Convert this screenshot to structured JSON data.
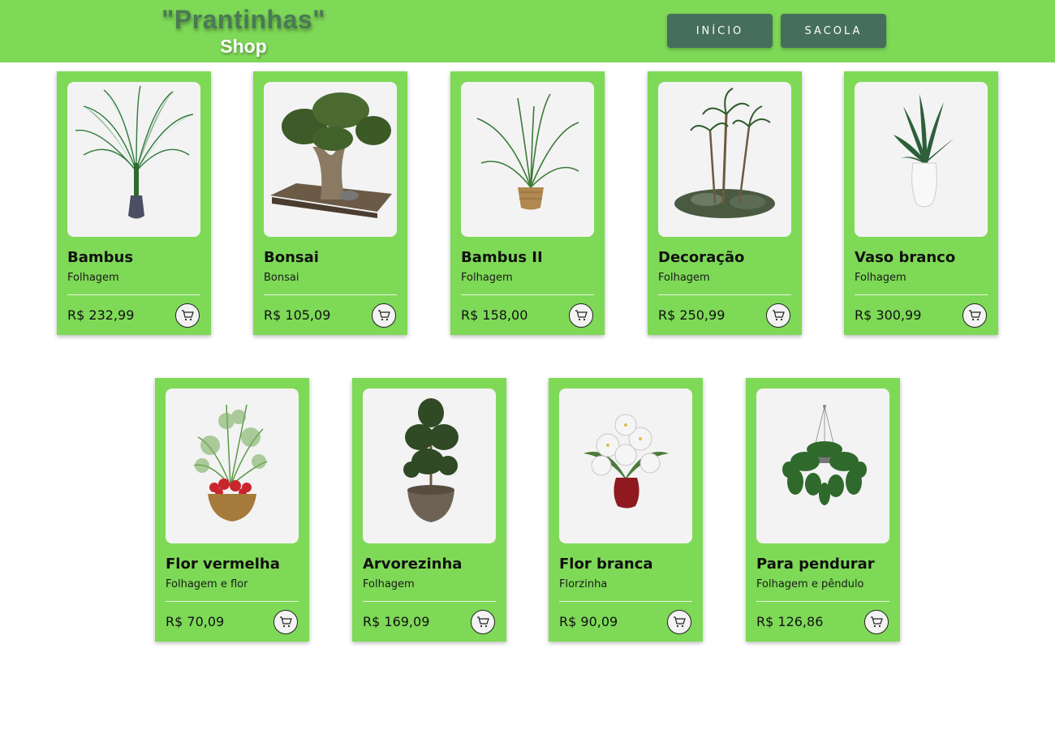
{
  "header": {
    "logo_title": "\"Prantinhas\"",
    "logo_subtitle": "Shop",
    "nav": [
      {
        "label": "INÍCIO"
      },
      {
        "label": "SACOLA"
      }
    ]
  },
  "colors": {
    "header_bg": "#7ed957",
    "card_bg": "#7ed957",
    "nav_button_bg": "#466e5d",
    "logo_title_color": "#4a7a55"
  },
  "products": [
    {
      "name": "Bambus",
      "category": "Folhagem",
      "price": "R$ 232,99",
      "image_icon": "palm-plant-icon"
    },
    {
      "name": "Bonsai",
      "category": "Bonsai",
      "price": "R$ 105,09",
      "image_icon": "bonsai-tree-icon"
    },
    {
      "name": "Bambus II",
      "category": "Folhagem",
      "price": "R$ 158,00",
      "image_icon": "potted-palm-icon"
    },
    {
      "name": "Decoração",
      "category": "Folhagem",
      "price": "R$ 250,99",
      "image_icon": "palm-island-icon"
    },
    {
      "name": "Vaso branco",
      "category": "Folhagem",
      "price": "R$ 300,99",
      "image_icon": "white-vase-plant-icon"
    },
    {
      "name": "Flor vermelha",
      "category": "Folhagem e flor",
      "price": "R$ 70,09",
      "image_icon": "red-flower-pot-icon"
    },
    {
      "name": "Arvorezinha",
      "category": "Folhagem",
      "price": "R$ 169,09",
      "image_icon": "small-tree-pot-icon"
    },
    {
      "name": "Flor branca",
      "category": "Florzinha",
      "price": "R$ 90,09",
      "image_icon": "white-lily-vase-icon"
    },
    {
      "name": "Para pendurar",
      "category": "Folhagem e pêndulo",
      "price": "R$ 126,86",
      "image_icon": "hanging-plant-icon"
    }
  ]
}
